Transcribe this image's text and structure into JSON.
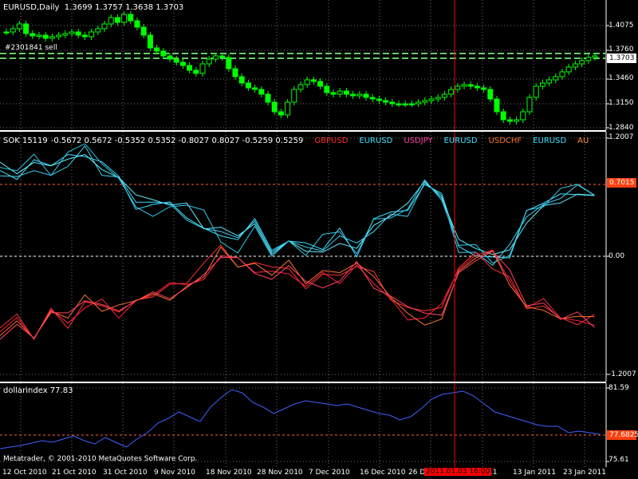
{
  "chart_pane": {
    "title": "EURUSD,Daily",
    "ohlc": "1.3699 1.3757 1.3638 1.3703",
    "order_label": "#2301841 sell",
    "price_ticks": [
      "1.4075",
      "1.3760",
      "1.3460",
      "1.3150",
      "1.2840"
    ],
    "current_price": "1.3703",
    "colors": {
      "candle": "#00ff00",
      "line": "#00cc00",
      "level": "#66cc66"
    }
  },
  "indicator_pane": {
    "name": "SOK 15119",
    "values": "-0.5672 0.5672 -0.5352 0.5352 -0.8027 0.8027 -0.5259 0.5259",
    "legend": [
      {
        "label": "GBPUSD",
        "color": "#ff3030"
      },
      {
        "label": "EURUSD",
        "color": "#40e0ff"
      },
      {
        "label": "USDJPY",
        "color": "#ff40a0"
      },
      {
        "label": "EURUSD",
        "color": "#40e0ff"
      },
      {
        "label": "USDCHF",
        "color": "#ff7030"
      },
      {
        "label": "EURUSD",
        "color": "#40e0ff"
      },
      {
        "label": "AU",
        "color": "#ff9030"
      }
    ],
    "ticks": [
      "1.2007",
      "0.00",
      "-1.2007"
    ],
    "level_tag": "0.7015"
  },
  "dollar_pane": {
    "name": "dollarindex 77.83",
    "ticks": [
      "81.59",
      "75.61"
    ],
    "level_tag": "77.6825",
    "line_color": "#4060ff"
  },
  "copyright": "Metatrader, © 2001-2010 MetaQuotes Software Corp.",
  "x_axis": {
    "labels": [
      "12 Oct 2010",
      "21 Oct 2010",
      "31 Oct 2010",
      "9 Nov 2010",
      "18 Nov 2010",
      "28 Nov 2010",
      "7 Dec 2010",
      "16 Dec 2010",
      "26 D",
      "11",
      "13 Jan 2011",
      "23 Jan 2011"
    ],
    "cursor_time": "2011.01.03 16:00"
  }
}
